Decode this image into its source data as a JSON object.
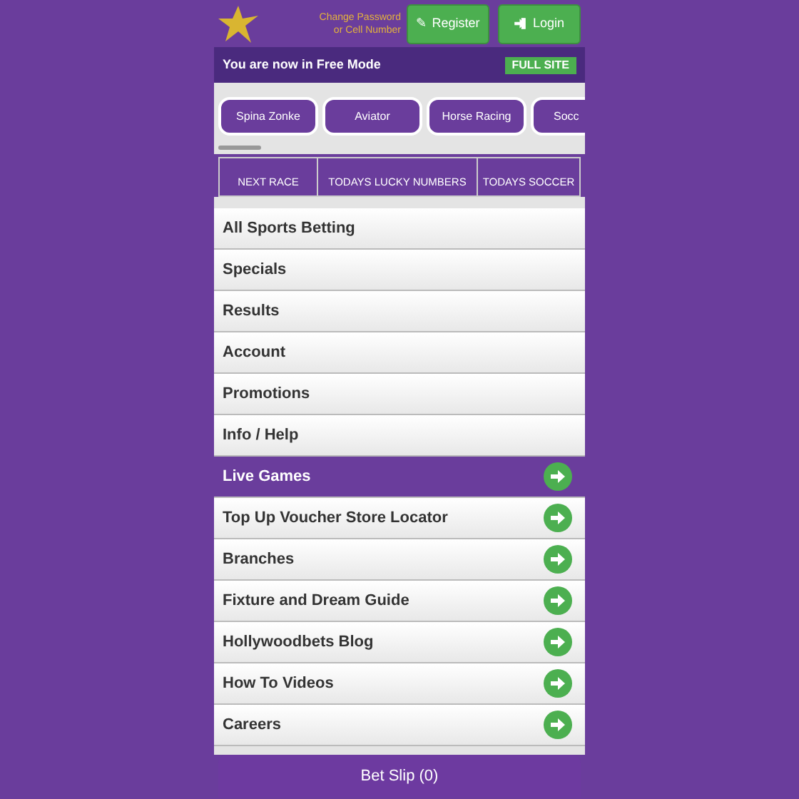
{
  "header": {
    "account_link": "Change Password or Cell Number",
    "register_button": {
      "icon": "✎",
      "label": "Register"
    },
    "login_button": "Login"
  },
  "mode_bar": {
    "message": "You are now in Free Mode",
    "button": "FULL SITE"
  },
  "game_tabs": [
    "Spina Zonke",
    "Aviator",
    "Horse Racing",
    "Socc"
  ],
  "quick_links": [
    "NEXT RACE",
    "TODAYS LUCKY NUMBERS",
    "TODAYS SOCCER"
  ],
  "menu": [
    {
      "label": "All Sports Betting",
      "kind": "plain",
      "selected": false
    },
    {
      "label": "Specials",
      "kind": "plain",
      "selected": false
    },
    {
      "label": "Results",
      "kind": "plain",
      "selected": false
    },
    {
      "label": "Account",
      "kind": "plain",
      "selected": false
    },
    {
      "label": "Promotions",
      "kind": "plain",
      "selected": false
    },
    {
      "label": "Info / Help",
      "kind": "plain",
      "selected": false
    },
    {
      "label": "Live Games",
      "kind": "arrow",
      "selected": true
    },
    {
      "label": "Top Up Voucher Store Locator",
      "kind": "arrow",
      "selected": false
    },
    {
      "label": "Branches",
      "kind": "arrow",
      "selected": false
    },
    {
      "label": "Fixture and Dream Guide",
      "kind": "arrow",
      "selected": false
    },
    {
      "label": "Hollywoodbets Blog",
      "kind": "arrow",
      "selected": false
    },
    {
      "label": "How To Videos",
      "kind": "arrow",
      "selected": false
    },
    {
      "label": "Careers",
      "kind": "arrow",
      "selected": false
    }
  ],
  "bet_slip": "Bet Slip (0)"
}
